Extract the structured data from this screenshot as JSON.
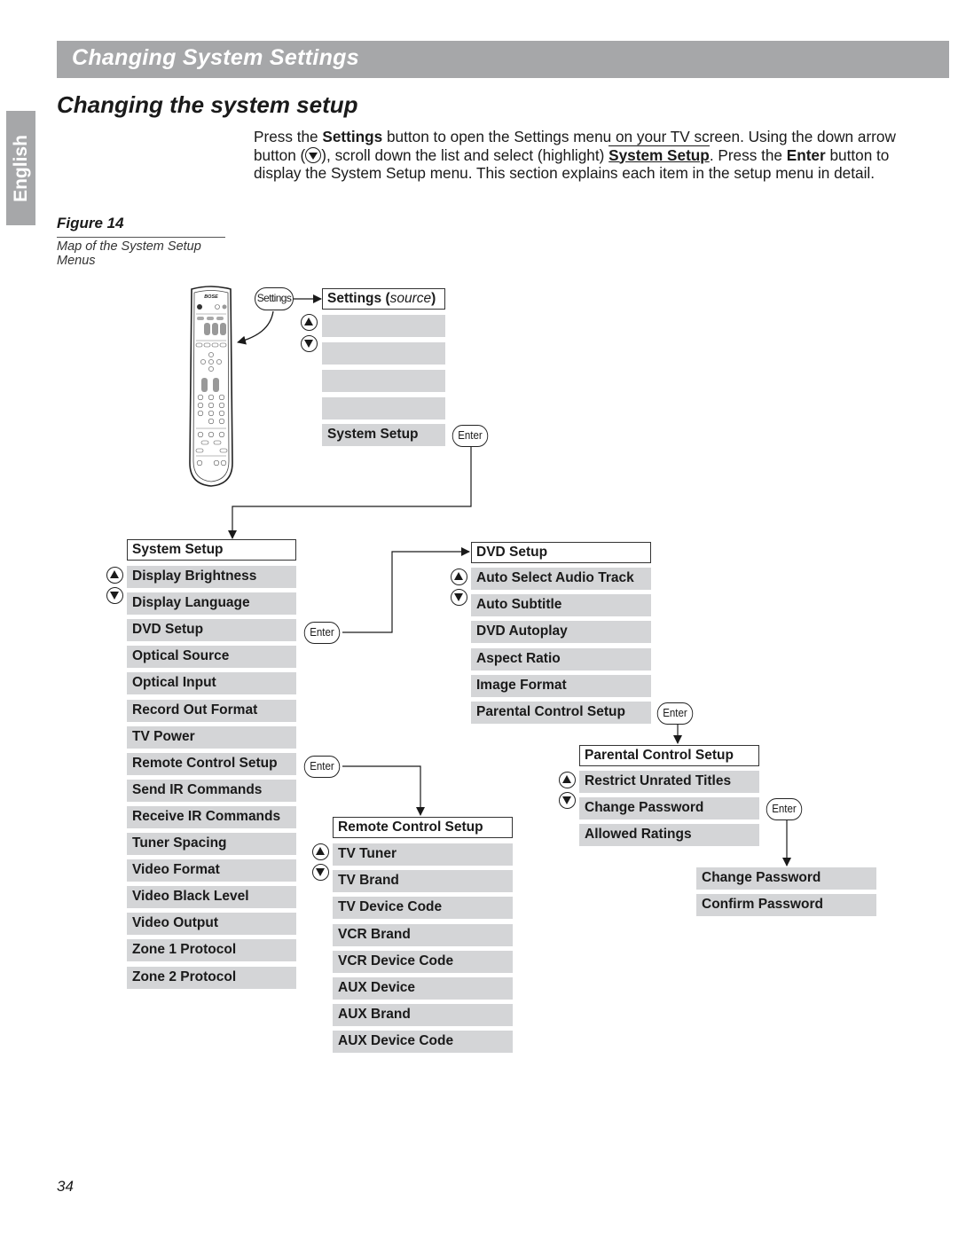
{
  "header": {
    "section_title": "Changing System Settings",
    "language_tab": "English",
    "page_title": "Changing the system setup"
  },
  "intro": {
    "part1": "Press the ",
    "settings_word": "Settings",
    "part2": " button to open the Settings menu on your TV screen. Using the down arrow button (",
    "arrow_icon": "down-arrow-button-icon",
    "part3": "), scroll down the list and select (highlight) ",
    "highlight": "System Setup",
    "part4": ". Press the ",
    "enter_word": "Enter",
    "part5": " button to display the System Setup menu. This section explains each item in the setup menu in detail."
  },
  "figure": {
    "label": "Figure 14",
    "caption": "Map of the System Setup Menus"
  },
  "remote": {
    "icon": "bose-remote-control-icon",
    "settings_button": "Settings"
  },
  "settings_menu": {
    "title_main": "Settings (",
    "title_source": "source",
    "title_close": ")",
    "items": [
      "",
      "",
      "",
      "",
      "System Setup"
    ],
    "enter_label": "Enter"
  },
  "system_setup_menu": {
    "title": "System Setup",
    "items": [
      "Display Brightness",
      "Display Language",
      "DVD Setup",
      "Optical Source",
      "Optical Input",
      "Record Out Format",
      "TV Power",
      "Remote Control Setup",
      "Send IR Commands",
      "Receive IR Commands",
      "Tuner Spacing",
      "Video Format",
      "Video Black Level",
      "Video Output",
      "Zone 1 Protocol",
      "Zone 2 Protocol"
    ],
    "dvd_enter_label": "Enter",
    "remote_enter_label": "Enter"
  },
  "dvd_setup_menu": {
    "title": "DVD Setup",
    "items": [
      "Auto Select Audio Track",
      "Auto Subtitle",
      "DVD Autoplay",
      "Aspect Ratio",
      "Image Format",
      "Parental Control Setup"
    ],
    "enter_label": "Enter"
  },
  "parental_control_menu": {
    "title": "Parental Control Setup",
    "items": [
      "Restrict Unrated Titles",
      "Change Password",
      "Allowed Ratings"
    ],
    "enter_label": "Enter"
  },
  "password_menu": {
    "items": [
      "Change Password",
      "Confirm Password"
    ]
  },
  "remote_control_menu": {
    "title": "Remote Control Setup",
    "items": [
      "TV Tuner",
      "TV Brand",
      "TV Device Code",
      "VCR Brand",
      "VCR Device Code",
      "AUX Device",
      "AUX Brand",
      "AUX Device Code"
    ]
  },
  "page_number": "34",
  "colors": {
    "header_gray": "#a6a7a9",
    "menu_item_gray": "#d4d5d7",
    "text": "#1a1a1a"
  }
}
